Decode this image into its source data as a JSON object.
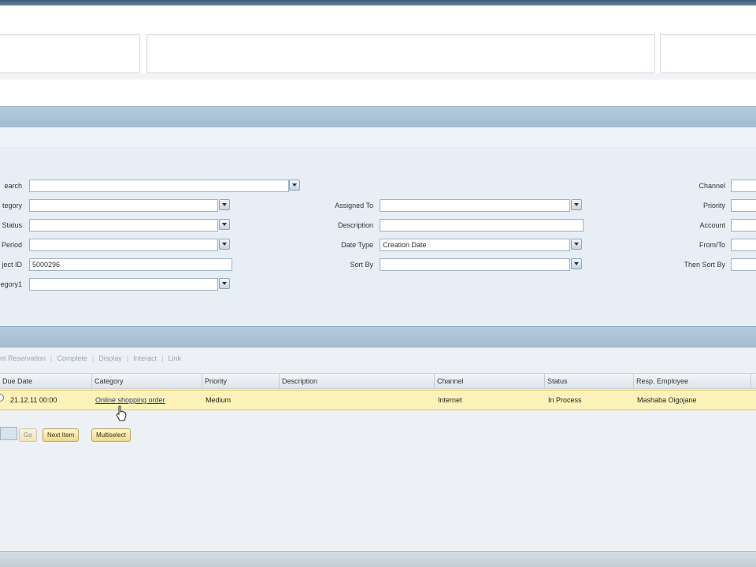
{
  "search": {
    "labels": {
      "search": "earch",
      "category": "tegory",
      "status": "Status",
      "period": "Period",
      "object_id": "ject ID",
      "category1": "egory1",
      "assigned_to": "Assigned To",
      "description": "Description",
      "date_type": "Date Type",
      "sort_by": "Sort By",
      "channel": "Channel",
      "priority": "Priority",
      "account": "Account",
      "from_to": "From/To",
      "then_sort_by": "Then Sort By"
    },
    "values": {
      "search": "",
      "category": "",
      "status": "",
      "period": "",
      "object_id": "5000296",
      "category1": "",
      "assigned_to": "",
      "description": "",
      "date_type": "Creation Date",
      "sort_by": "",
      "channel": "",
      "priority": "",
      "account": "",
      "from_to": "",
      "then_sort_by": ""
    }
  },
  "toolbar": {
    "items": [
      "nt Reservation",
      "Complete",
      "Display",
      "Interact",
      "Link"
    ]
  },
  "table": {
    "columns": [
      "Due Date",
      "Category",
      "Priority",
      "Description",
      "Channel",
      "Status",
      "Resp. Employee"
    ],
    "rows": [
      {
        "due_date": "21.12.11 00:00",
        "category": "Online shopping order",
        "priority": "Medium",
        "description": "",
        "channel": "Internet",
        "status": "In Process",
        "resp_employee": "Mashaba Oigojane"
      }
    ]
  },
  "pager": {
    "go": "Go",
    "next_item": "Next Item",
    "multiselect": "Multiselect"
  },
  "colors": {
    "header_bar": "#a3bcd1",
    "selected_row": "#fdf3b8",
    "link": "#1d3f79"
  }
}
